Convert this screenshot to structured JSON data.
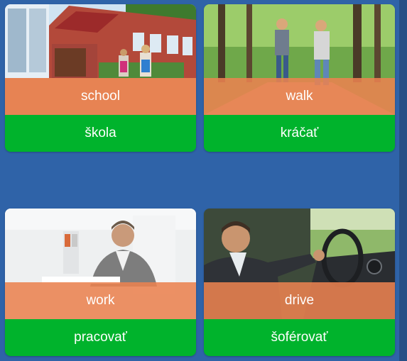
{
  "colors": {
    "background": "#2f63a8",
    "english_band": "#ea8250",
    "translation_band": "#00b32c",
    "text": "#ffffff"
  },
  "cards": [
    {
      "english": "school",
      "translation": "škola",
      "image": "school-building-children-photo"
    },
    {
      "english": "walk",
      "translation": "kráčať",
      "image": "women-walking-in-park-photo"
    },
    {
      "english": "work",
      "translation": "pracovať",
      "image": "man-working-at-desk-photo"
    },
    {
      "english": "drive",
      "translation": "šoférovať",
      "image": "man-driving-car-photo"
    }
  ]
}
